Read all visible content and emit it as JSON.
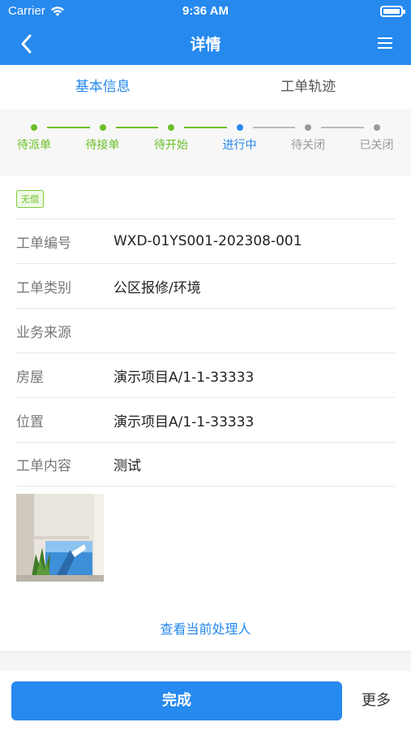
{
  "status_bar": {
    "carrier": "Carrier",
    "time": "9:36 AM"
  },
  "navbar": {
    "title": "详情"
  },
  "tabs": [
    {
      "label": "基本信息",
      "active": true
    },
    {
      "label": "工单轨迹",
      "active": false
    }
  ],
  "stepper": {
    "steps": [
      {
        "label": "待派单",
        "state": "done"
      },
      {
        "label": "待接单",
        "state": "done"
      },
      {
        "label": "待开始",
        "state": "done"
      },
      {
        "label": "进行中",
        "state": "current"
      },
      {
        "label": "待关闭",
        "state": "pending"
      },
      {
        "label": "已关闭",
        "state": "pending"
      }
    ]
  },
  "badge": "无偿",
  "details": [
    {
      "key": "工单编号",
      "value": "WXD-01YS001-202308-001"
    },
    {
      "key": "工单类别",
      "value": "公区报修/环境"
    },
    {
      "key": "业务来源",
      "value": ""
    },
    {
      "key": "房屋",
      "value": "演示项目A/1-1-33333"
    },
    {
      "key": "位置",
      "value": "演示项目A/1-1-33333"
    },
    {
      "key": "工单内容",
      "value": "测试"
    }
  ],
  "handler_link": "查看当前处理人",
  "actions": {
    "done": "完成",
    "more": "更多"
  },
  "colors": {
    "primary": "#2689ee",
    "done": "#6bbf26",
    "pending": "#999999"
  }
}
